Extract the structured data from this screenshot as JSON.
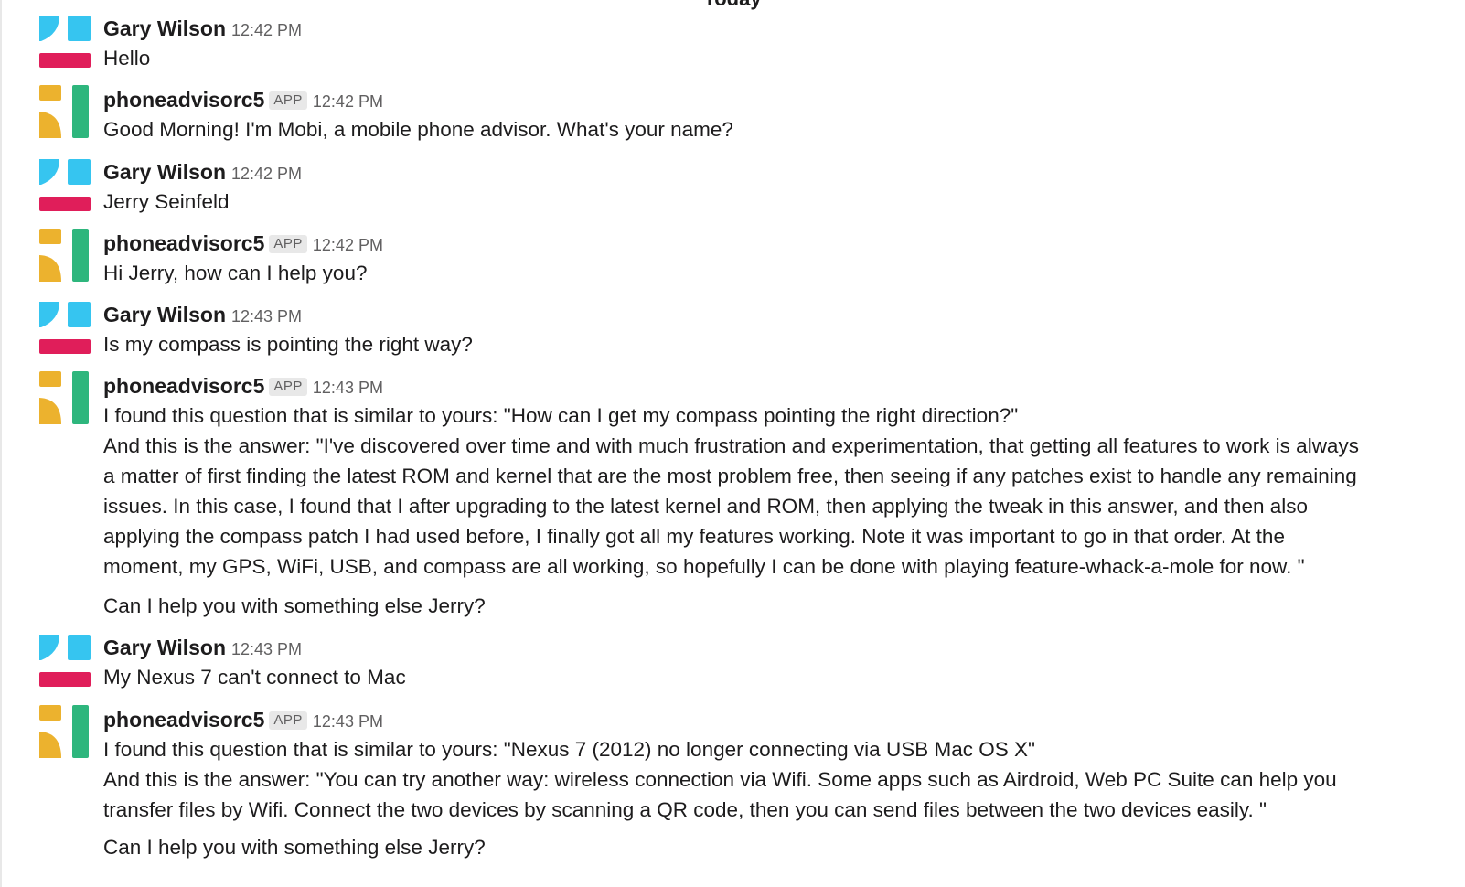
{
  "day_divider": "Today",
  "colors": {
    "gary_blue": "#36c5f0",
    "gary_red": "#e01e5a",
    "bot_yellow": "#ecb22e",
    "bot_green": "#2eb67d"
  },
  "messages": [
    {
      "author": "Gary Wilson",
      "avatar": "gary-avatar-icon",
      "time": "12:42 PM",
      "lines": [
        "Hello"
      ]
    },
    {
      "author": "phoneadvisorc5",
      "avatar": "bot-avatar-icon",
      "badge": "APP",
      "time": "12:42 PM",
      "lines": [
        "Good Morning! I'm Mobi, a mobile phone advisor. What's your name?"
      ]
    },
    {
      "author": "Gary Wilson",
      "avatar": "gary-avatar-icon",
      "time": "12:42 PM",
      "lines": [
        "Jerry Seinfeld"
      ]
    },
    {
      "author": "phoneadvisorc5",
      "avatar": "bot-avatar-icon",
      "badge": "APP",
      "time": "12:42 PM",
      "lines": [
        "Hi Jerry, how can I help you?"
      ]
    },
    {
      "author": "Gary Wilson",
      "avatar": "gary-avatar-icon",
      "time": "12:43 PM",
      "lines": [
        "Is my compass is pointing the right way?"
      ]
    },
    {
      "author": "phoneadvisorc5",
      "avatar": "bot-avatar-icon",
      "badge": "APP",
      "time": "12:43 PM",
      "lines": [
        "I found this question that is similar to yours: \"How can I get my compass pointing the right direction?\"",
        "And this is the answer: \"I've discovered over time and with much frustration and experimentation, that getting all features to work is always",
        "a matter of first finding the latest ROM and kernel that are the most problem free, then seeing if any patches exist to handle any remaining",
        "issues. In this case, I found that I after upgrading to the latest kernel and ROM, then applying the tweak in this answer, and then also",
        "applying the compass patch I had used before, I finally got all my features working. Note it was important to go in that order. At the",
        "moment, my GPS, WiFi, USB, and compass are all working, so hopefully I can be done with playing feature-whack-a-mole for now. \""
      ],
      "followup": "Can I help you with something else Jerry?"
    },
    {
      "author": "Gary Wilson",
      "avatar": "gary-avatar-icon",
      "time": "12:43 PM",
      "lines": [
        "My Nexus 7 can't connect to Mac"
      ]
    },
    {
      "author": "phoneadvisorc5",
      "avatar": "bot-avatar-icon",
      "badge": "APP",
      "time": "12:43 PM",
      "lines": [
        "I found this question that is similar to yours: \"Nexus 7 (2012) no longer connecting via USB Mac OS X\"",
        "And this is the answer: \"You can try another way: wireless connection via Wifi. Some apps such as Airdroid, Web PC Suite can help you",
        "transfer files by Wifi. Connect the two devices by scanning a QR code, then you can send files between the two devices easily. \""
      ],
      "followup": "Can I help you with something else Jerry?"
    }
  ]
}
